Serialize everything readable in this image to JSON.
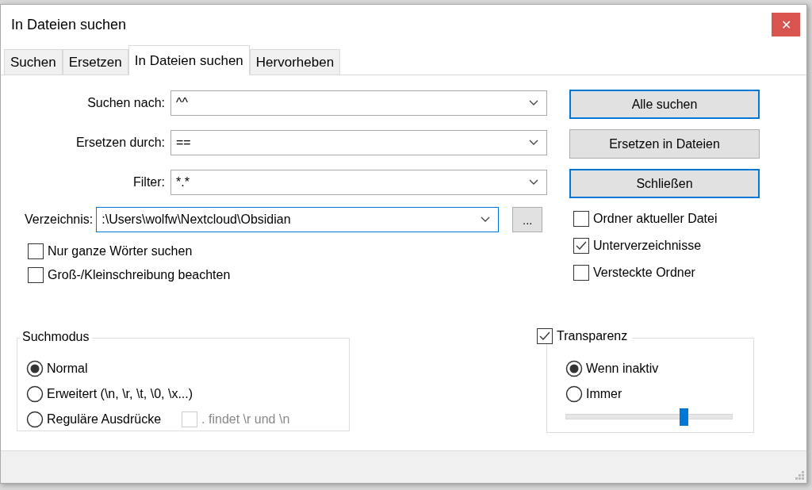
{
  "window": {
    "title": "In Dateien suchen",
    "close": "✕"
  },
  "tabs": [
    {
      "label": "Suchen",
      "selected": false
    },
    {
      "label": "Ersetzen",
      "selected": false
    },
    {
      "label": "In Dateien suchen",
      "selected": true
    },
    {
      "label": "Hervorheben",
      "selected": false
    }
  ],
  "fields": [
    {
      "label": "Suchen nach:",
      "value": "^^"
    },
    {
      "label": "Ersetzen durch:",
      "value": "=="
    },
    {
      "label": "Filter:",
      "value": "*.*"
    }
  ],
  "directory": {
    "label": "Verzeichnis:",
    "value": ":\\Users\\wolfw\\Nextcloud\\Obsidian",
    "browse": "..."
  },
  "options": [
    {
      "label": "Nur ganze Wörter suchen",
      "checked": false
    },
    {
      "label": "Groß-/Kleinschreibung beachten",
      "checked": false
    }
  ],
  "buttons": [
    {
      "label": "Alle suchen",
      "default": true
    },
    {
      "label": "Ersetzen in Dateien",
      "default": false
    },
    {
      "label": "Schließen",
      "default": true
    }
  ],
  "folder_options": [
    {
      "label": "Ordner aktueller Datei",
      "checked": false
    },
    {
      "label": "Unterverzeichnisse",
      "checked": true
    },
    {
      "label": "Versteckte Ordner",
      "checked": false
    }
  ],
  "search_mode": {
    "title": "Suchmodus",
    "modes": [
      {
        "label": "Normal",
        "selected": true
      },
      {
        "label": "Erweitert (\\n, \\r, \\t, \\0, \\x...)",
        "selected": false
      },
      {
        "label": "Reguläre Ausdrücke",
        "selected": false
      }
    ],
    "dot_option": {
      "label": ". findet \\r und \\n",
      "checked": false,
      "disabled": true
    }
  },
  "transparency": {
    "label": "Transparenz",
    "checked": true,
    "modes": [
      {
        "label": "Wenn inaktiv",
        "selected": true
      },
      {
        "label": "Immer",
        "selected": false
      }
    ],
    "level": 0.71
  }
}
